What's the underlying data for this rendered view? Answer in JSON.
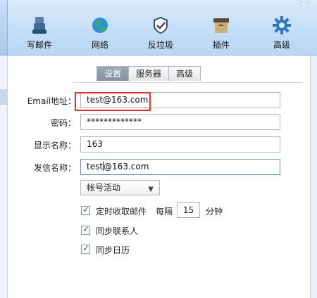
{
  "window": {
    "close_glyph": "×"
  },
  "toolbar": {
    "items": [
      {
        "label": "写邮件",
        "icon": "compose-icon"
      },
      {
        "label": "网络",
        "icon": "globe-icon"
      },
      {
        "label": "反垃圾",
        "icon": "shield-icon"
      },
      {
        "label": "插件",
        "icon": "plugin-box-icon"
      },
      {
        "label": "高级",
        "icon": "gear-icon"
      }
    ]
  },
  "tabs": [
    {
      "label": "设置",
      "active": true
    },
    {
      "label": "服务器",
      "active": false
    },
    {
      "label": "高级",
      "active": false
    }
  ],
  "form": {
    "email_label": "Email地址：",
    "email_value": "test@163.com",
    "password_label": "密码：",
    "password_value": "*************",
    "display_name_label": "显示名称：",
    "display_name_value": "163",
    "sender_name_label": "发信名称：",
    "sender_name_value_before_caret": "test",
    "sender_name_value_after_caret": "@163.com",
    "account_status": "帐号活动",
    "auto_receive_label": "定时收取邮件",
    "auto_receive_checked": true,
    "interval_prefix": "每隔",
    "interval_value": "15",
    "interval_unit": "分钟",
    "sync_contacts_label": "同步联系人",
    "sync_contacts_checked": true,
    "sync_calendar_label": "同步日历",
    "sync_calendar_checked": true
  },
  "colors": {
    "highlight_box": "#e03131",
    "toolbar_bg": "#c5def6"
  }
}
